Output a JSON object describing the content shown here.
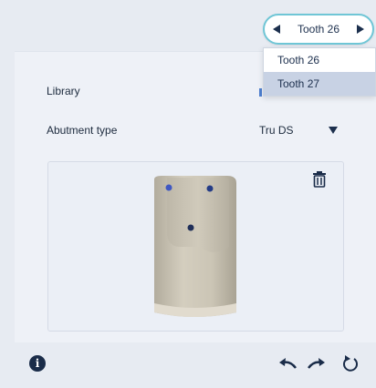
{
  "tooth_selector": {
    "current": "Tooth 26",
    "prev_icon": "arrow-left-icon",
    "next_icon": "arrow-right-icon"
  },
  "dropdown": {
    "items": [
      {
        "label": "Tooth 26",
        "selected": false
      },
      {
        "label": "Tooth 27",
        "selected": true
      }
    ]
  },
  "settings": {
    "library_label": "Library",
    "library_value": "",
    "abutment_label": "Abutment type",
    "abutment_value": "Tru DS"
  },
  "preview": {
    "delete_icon": "trash-icon"
  },
  "footer": {
    "info_icon": "info-icon",
    "undo_icon": "undo-icon",
    "redo_icon": "redo-icon",
    "reset_icon": "reset-icon"
  },
  "colors": {
    "accent": "#6fc6d6",
    "dark": "#1a2c49",
    "selected_bg": "#c8d2e4"
  }
}
